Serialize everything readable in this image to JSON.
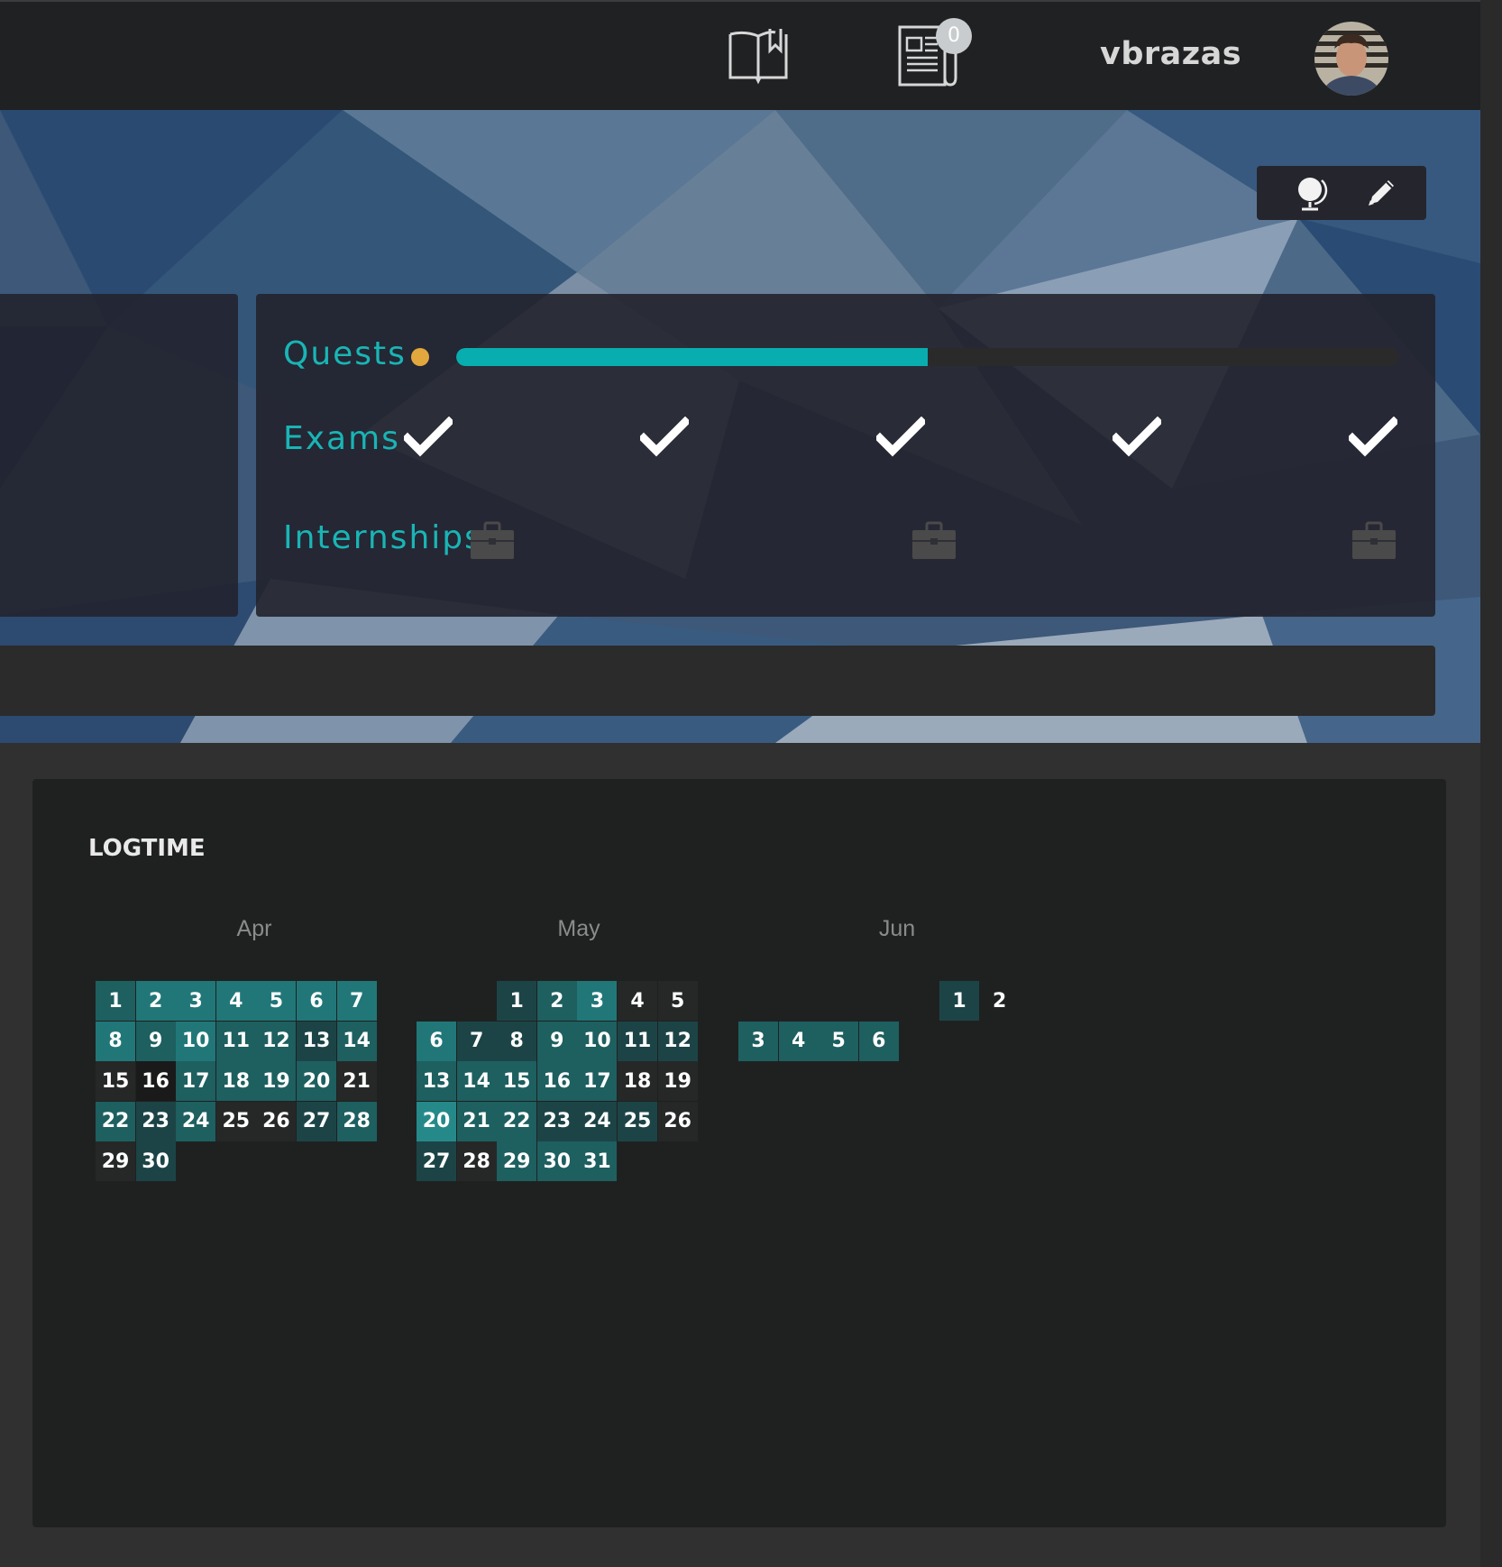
{
  "header": {
    "notification_count": "0",
    "username": "vbrazas",
    "icons": [
      "book-bookmark-icon",
      "news-paperclip-icon"
    ]
  },
  "profile_tools": {
    "icons": [
      "globe-lightbulb-icon",
      "pencil-icon"
    ]
  },
  "progress": {
    "quests_label": "Quests",
    "exams_label": "Exams",
    "internships_label": "Internships",
    "quests_progress": 0.5,
    "exams_completed": 5,
    "internships_count": 3
  },
  "logtime": {
    "title": "LOGTIME",
    "months": [
      {
        "label": "Apr",
        "days": [
          {
            "day": "1",
            "level": 2
          },
          {
            "day": "2",
            "level": 3
          },
          {
            "day": "3",
            "level": 3
          },
          {
            "day": "4",
            "level": 3
          },
          {
            "day": "5",
            "level": 3
          },
          {
            "day": "6",
            "level": 3
          },
          {
            "day": "7",
            "level": 3
          },
          {
            "day": "8",
            "level": 3
          },
          {
            "day": "9",
            "level": 2
          },
          {
            "day": "10",
            "level": 3
          },
          {
            "day": "11",
            "level": 2
          },
          {
            "day": "12",
            "level": 2
          },
          {
            "day": "13",
            "level": 1
          },
          {
            "day": "14",
            "level": 2
          },
          {
            "day": "15",
            "level": 0
          },
          {
            "day": "16",
            "level": -1
          },
          {
            "day": "17",
            "level": 2
          },
          {
            "day": "18",
            "level": 2
          },
          {
            "day": "19",
            "level": 2
          },
          {
            "day": "20",
            "level": 2
          },
          {
            "day": "21",
            "level": 0
          },
          {
            "day": "22",
            "level": 2
          },
          {
            "day": "23",
            "level": 1
          },
          {
            "day": "24",
            "level": 2
          },
          {
            "day": "25",
            "level": 0
          },
          {
            "day": "26",
            "level": 0
          },
          {
            "day": "27",
            "level": 1
          },
          {
            "day": "28",
            "level": 2
          },
          {
            "day": "29",
            "level": 0
          },
          {
            "day": "30",
            "level": 1
          }
        ]
      },
      {
        "label": "May",
        "days": [
          {
            "day": "1",
            "level": 1
          },
          {
            "day": "2",
            "level": 2
          },
          {
            "day": "3",
            "level": 3
          },
          {
            "day": "4",
            "level": 0
          },
          {
            "day": "5",
            "level": 0
          },
          {
            "day": "6",
            "level": 3
          },
          {
            "day": "7",
            "level": 1
          },
          {
            "day": "8",
            "level": 1
          },
          {
            "day": "9",
            "level": 2
          },
          {
            "day": "10",
            "level": 2
          },
          {
            "day": "11",
            "level": 1
          },
          {
            "day": "12",
            "level": 1
          },
          {
            "day": "13",
            "level": 2
          },
          {
            "day": "14",
            "level": 2
          },
          {
            "day": "15",
            "level": 2
          },
          {
            "day": "16",
            "level": 2
          },
          {
            "day": "17",
            "level": 2
          },
          {
            "day": "18",
            "level": 0
          },
          {
            "day": "19",
            "level": 0
          },
          {
            "day": "20",
            "level": 4
          },
          {
            "day": "21",
            "level": 2
          },
          {
            "day": "22",
            "level": 2
          },
          {
            "day": "23",
            "level": 1
          },
          {
            "day": "24",
            "level": 1
          },
          {
            "day": "25",
            "level": 1
          },
          {
            "day": "26",
            "level": 0
          },
          {
            "day": "27",
            "level": 1
          },
          {
            "day": "28",
            "level": 0
          },
          {
            "day": "29",
            "level": 2
          },
          {
            "day": "30",
            "level": 2
          },
          {
            "day": "31",
            "level": 2
          }
        ]
      },
      {
        "label": "Jun",
        "days": [
          {
            "day": "1",
            "level": 1
          },
          {
            "day": "2",
            "level": -2
          },
          {
            "day": "3",
            "level": 2
          },
          {
            "day": "4",
            "level": 2
          },
          {
            "day": "5",
            "level": 2
          },
          {
            "day": "6",
            "level": 2
          }
        ]
      }
    ]
  },
  "colors": {
    "accent": "#19b5b5",
    "quest_dot": "#e2a83d",
    "progress_fill": "#08adaf",
    "logtime_levels": {
      "-2": "transparent",
      "-1": "#1a1a1a",
      "0": "#262828",
      "1": "#1c4446",
      "2": "#1e5f60",
      "3": "#217778",
      "4": "#25898a"
    }
  }
}
